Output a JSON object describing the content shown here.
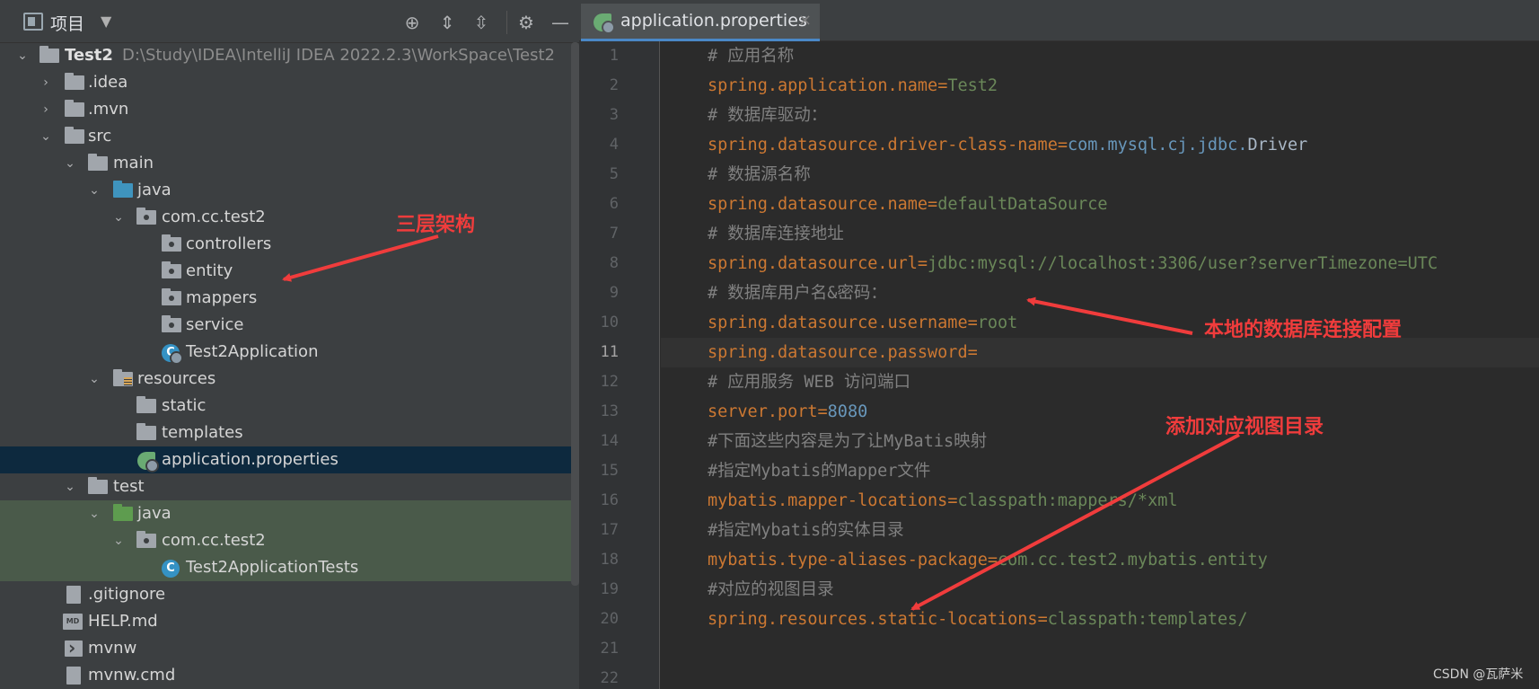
{
  "project_panel": {
    "title": "项目",
    "dropdown_icon": "chevron-down-icon",
    "toolbar_icons": [
      "locate-icon",
      "expand-all-icon",
      "collapse-all-icon",
      "gear-icon",
      "minimize-icon"
    ]
  },
  "tree": {
    "root_name": "Test2",
    "root_path": "D:\\Study\\IDEA\\IntelliJ IDEA 2022.2.3\\WorkSpace\\Test2",
    "idea": ".idea",
    "mvn": ".mvn",
    "src": "src",
    "main": "main",
    "java": "java",
    "main_pkg": "com.cc.test2",
    "controllers": "controllers",
    "entity": "entity",
    "mappers": "mappers",
    "service": "service",
    "app_class": "Test2Application",
    "resources": "resources",
    "static": "static",
    "templates": "templates",
    "app_props": "application.properties",
    "test": "test",
    "test_java": "java",
    "test_pkg": "com.cc.test2",
    "test_class": "Test2ApplicationTests",
    "gitignore": ".gitignore",
    "help": "HELP.md",
    "help_badge": "MD",
    "mvnw": "mvnw",
    "mvnw_cmd": "mvnw.cmd"
  },
  "editor": {
    "tab_label": "application.properties",
    "tab_close": "×",
    "line_numbers": [
      "1",
      "2",
      "3",
      "4",
      "5",
      "6",
      "7",
      "8",
      "9",
      "10",
      "11",
      "12",
      "13",
      "14",
      "15",
      "16",
      "17",
      "18",
      "19",
      "20",
      "21",
      "22"
    ],
    "current_line": "11",
    "code": {
      "l1": "# 应用名称",
      "l2_key": "spring.application.name",
      "l2_val": "Test2",
      "l3": "# 数据库驱动：",
      "l4_key": "spring.datasource.driver-class-name",
      "l4_val_pkg": "com.mysql.cj.jdbc.",
      "l4_val_cls": "Driver",
      "l5": "# 数据源名称",
      "l6_key": "spring.datasource.name",
      "l6_val": "defaultDataSource",
      "l7": "# 数据库连接地址",
      "l8_key": "spring.datasource.url",
      "l8_val": "jdbc:mysql://localhost:3306/user?serverTimezone=UTC",
      "l9": "# 数据库用户名&密码：",
      "l10_key": "spring.datasource.username",
      "l10_val": "root",
      "l11_key": "spring.datasource.password",
      "l12": "# 应用服务 WEB 访问端口",
      "l13_key": "server.port",
      "l13_val": "8080",
      "l14": "#下面这些内容是为了让MyBatis映射",
      "l15": "#指定Mybatis的Mapper文件",
      "l16_key": "mybatis.mapper-locations",
      "l16_val": "classpath:mappers/*xml",
      "l17": "#指定Mybatis的实体目录",
      "l18_key": "mybatis.type-aliases-package",
      "l18_val": "com.cc.test2.mybatis.entity",
      "l19": "#对应的视图目录",
      "l20_key": "spring.resources.static-locations",
      "l20_val": "classpath:templates/",
      "eq": "="
    }
  },
  "annotations": {
    "three_layer": "三层架构",
    "db_config": "本地的数据库连接配置",
    "view_dir": "添加对应视图目录"
  },
  "watermark": "CSDN @瓦萨米",
  "colors": {
    "annotation": "#f03c3c",
    "key": "#cc7832",
    "value": "#6a8759",
    "number": "#6897bb",
    "comment": "#808080",
    "selection": "#0d293e",
    "test_bg": "#4a5a4a"
  }
}
